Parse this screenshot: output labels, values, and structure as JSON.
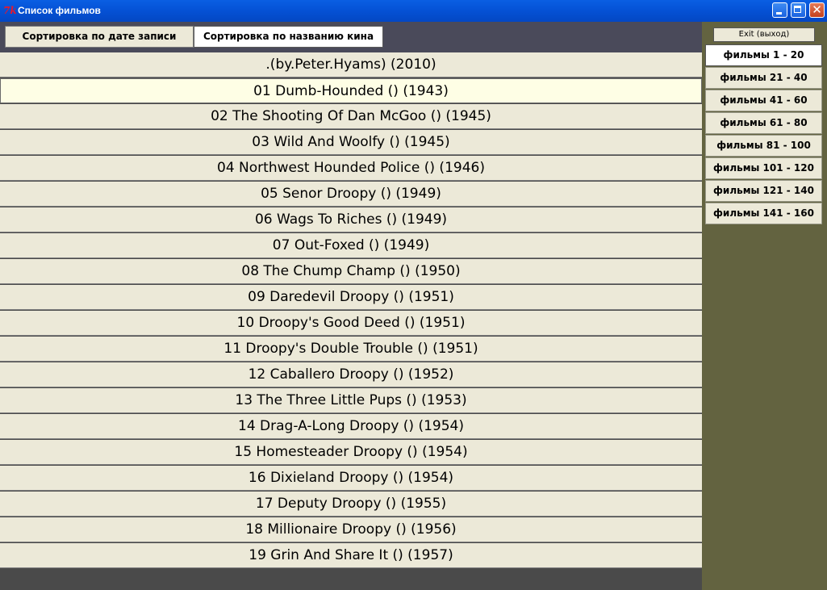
{
  "window": {
    "title": "Список фильмов",
    "icon_glyph": "7k",
    "min_glyph": "",
    "max_glyph": "",
    "close_glyph": "✕"
  },
  "sort": {
    "by_date_label": "Сортировка по дате записи",
    "by_name_label": "Сортировка по названию кина"
  },
  "films": [
    ".(by.Peter.Hyams) (2010)",
    "01 Dumb-Hounded () (1943)",
    "02 The Shooting Of Dan McGoo () (1945)",
    "03 Wild And Woolfy () (1945)",
    "04 Northwest Hounded Police () (1946)",
    "05 Senor Droopy () (1949)",
    "06 Wags To Riches () (1949)",
    "07 Out-Foxed () (1949)",
    "08 The Chump Champ () (1950)",
    "09 Daredevil Droopy () (1951)",
    "10 Droopy's Good Deed () (1951)",
    "11 Droopy's Double Trouble () (1951)",
    "12 Caballero Droopy () (1952)",
    "13 The Three Little Pups () (1953)",
    "14 Drag-A-Long Droopy () (1954)",
    "15 Homesteader Droopy () (1954)",
    "16 Dixieland Droopy () (1954)",
    "17 Deputy Droopy () (1955)",
    "18 Millionaire Droopy () (1956)",
    "19 Grin And Share It () (1957)"
  ],
  "exit_label": "Exit (выход)",
  "pages": [
    "фильмы 1 - 20",
    "фильмы 21 - 40",
    "фильмы 41 - 60",
    "фильмы 61 - 80",
    "фильмы 81 - 100",
    "фильмы 101 - 120",
    "фильмы 121 - 140",
    "фильмы 141 - 160"
  ],
  "colors": {
    "titlebar": "#0552d6",
    "list_bg": "#ece9d8",
    "highlight_row": "#fefee5",
    "right_panel": "#636340",
    "bottom_bg": "#4a4a4a"
  }
}
